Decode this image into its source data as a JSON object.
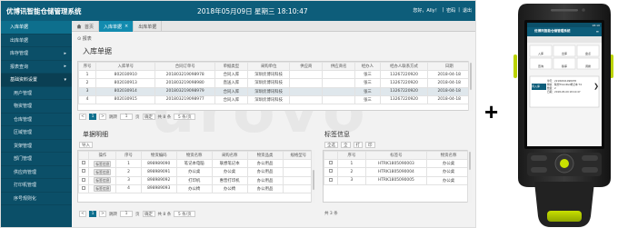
{
  "app": {
    "title": "优博讯智能仓储管理系统",
    "datetime": "2018年05月09日 星期三 18:10:47",
    "user_items": [
      "您好，Ally！",
      "|",
      "密码",
      "|",
      "退出"
    ]
  },
  "sidebar": [
    {
      "label": "入库单据",
      "kind": "active"
    },
    {
      "label": "出库单据",
      "kind": "normal"
    },
    {
      "label": "库存管理",
      "kind": "normal",
      "caret": "▸"
    },
    {
      "label": "报表查询",
      "kind": "normal",
      "caret": "▸"
    },
    {
      "label": "基础资料设置",
      "kind": "group",
      "caret": "▾"
    },
    {
      "label": "用户管理",
      "kind": "sub"
    },
    {
      "label": "物资管理",
      "kind": "sub"
    },
    {
      "label": "仓库管理",
      "kind": "sub"
    },
    {
      "label": "区域管理",
      "kind": "sub"
    },
    {
      "label": "货架管理",
      "kind": "sub"
    },
    {
      "label": "部门管理",
      "kind": "sub"
    },
    {
      "label": "供应商管理",
      "kind": "sub"
    },
    {
      "label": "打印机管理",
      "kind": "sub"
    },
    {
      "label": "序号规则化",
      "kind": "sub"
    }
  ],
  "tabs": [
    {
      "label": "首页",
      "icon": "home-icon",
      "active": false
    },
    {
      "label": "入库单据",
      "close": "×",
      "active": true
    },
    {
      "label": "出库单据",
      "close": "×",
      "active": false
    }
  ],
  "breadcrumb": "报表",
  "page_title": "入库单据",
  "inbound": {
    "headers": [
      "序号",
      "入库单号",
      "合同订单号",
      "单据类型",
      "采购单位",
      "供应商",
      "供应商名",
      "经办人",
      "经办人联系方式",
      "日期"
    ],
    "rows": [
      [
        "1",
        "802030910",
        "201803219098978",
        "合同入库",
        "深圳优博讯科技",
        "",
        "",
        "张三",
        "13267220920",
        "2018-04-18"
      ],
      [
        "2",
        "802030913",
        "201803219098980",
        "直送入库",
        "深圳优博讯科技",
        "",
        "",
        "张三",
        "13267220920",
        "2018-04-18"
      ],
      [
        "3",
        "802030914",
        "201803219098979",
        "合同入库",
        "深圳优博讯科技",
        "",
        "",
        "张三",
        "13267220920",
        "2018-04-18"
      ],
      [
        "4",
        "802030915",
        "201803219098977",
        "合同入库",
        "深圳优博讯科技",
        "",
        "",
        "张三",
        "13267220920",
        "2018-04-18"
      ]
    ],
    "selected_row": 2,
    "pager": {
      "prev": "<",
      "current": "1",
      "next": ">",
      "goto": "跳转",
      "page": "1",
      "page_unit": "页",
      "confirm": "确定",
      "total": "共 8 条",
      "per_page": "5 条/页"
    }
  },
  "detail": {
    "title": "单据明细",
    "toolbar": [
      "导入"
    ],
    "headers": [
      "",
      "操作",
      "序号",
      "物资编码",
      "物资名称",
      "采购名称",
      "物资品类",
      "规格型号"
    ],
    "rows": [
      [
        "",
        "",
        "1",
        "898989090",
        "笔记本电脑",
        "联想笔记本",
        "办公用品",
        ""
      ],
      [
        "",
        "",
        "2",
        "898989091",
        "办公桌",
        "办公桌",
        "办公用品",
        ""
      ],
      [
        "",
        "",
        "3",
        "898989092",
        "打印机",
        "惠普打印机",
        "办公用品",
        ""
      ],
      [
        "",
        "",
        "4",
        "898989093",
        "办公椅",
        "办公椅",
        "办公用品",
        ""
      ]
    ],
    "row_action_label": "标签信息",
    "pager": {
      "prev": "<",
      "current": "1",
      "next": ">",
      "goto": "跳转",
      "page": "1",
      "page_unit": "页",
      "confirm": "确定",
      "total": "共 8 条",
      "per_page": "5 条/页"
    }
  },
  "tags": {
    "title": "标签信息",
    "toolbar": [
      "全选",
      "全",
      "打",
      "印"
    ],
    "headers": [
      "",
      "序号",
      "标签号",
      "物资名称"
    ],
    "rows": [
      [
        "",
        "1",
        "HTRK1805090003",
        "办公桌"
      ],
      [
        "",
        "2",
        "HTRK1805090004",
        "办公桌"
      ],
      [
        "",
        "3",
        "HTRK1805090005",
        "办公桌"
      ]
    ],
    "total": "共 3 条"
  },
  "watermark": "urovo",
  "plus": "+",
  "device": {
    "status_time": "18:10",
    "app_title": "优博讯智能仓储管理系统",
    "menu_icon": "menu-icon",
    "grid_buttons": [
      "入库",
      "出库",
      "盘点",
      "查询",
      "移库",
      "调拨"
    ],
    "card_badge": "待入库",
    "card_lines": [
      "单号：22180321098978",
      "物资：联想ThinkPad笔记本 T4",
      "数量：2",
      "日期：2018-05-09 18:10:47"
    ],
    "arrow_right": "❯",
    "arrow_left": "❮"
  }
}
